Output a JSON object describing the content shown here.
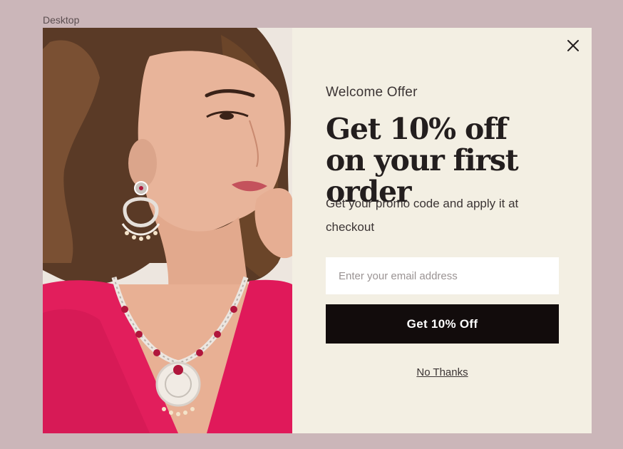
{
  "canvas": {
    "frame_label": "Desktop",
    "background_color": "#cbb6b9"
  },
  "popup": {
    "image": {
      "icon": "model-wearing-jewelry-photo"
    },
    "close_icon": "close-icon",
    "eyebrow": "Welcome Offer",
    "headline": "Get 10% off on your first order",
    "description": "Get your promo code and apply it at checkout",
    "email_field": {
      "value": "",
      "placeholder": "Enter your email address"
    },
    "cta_label": "Get 10% Off",
    "dismiss_label": "No Thanks",
    "colors": {
      "panel_background": "#f3efe3",
      "button_background": "#120c0c",
      "button_text": "#ffffff",
      "headline_text": "#231e1e"
    }
  }
}
